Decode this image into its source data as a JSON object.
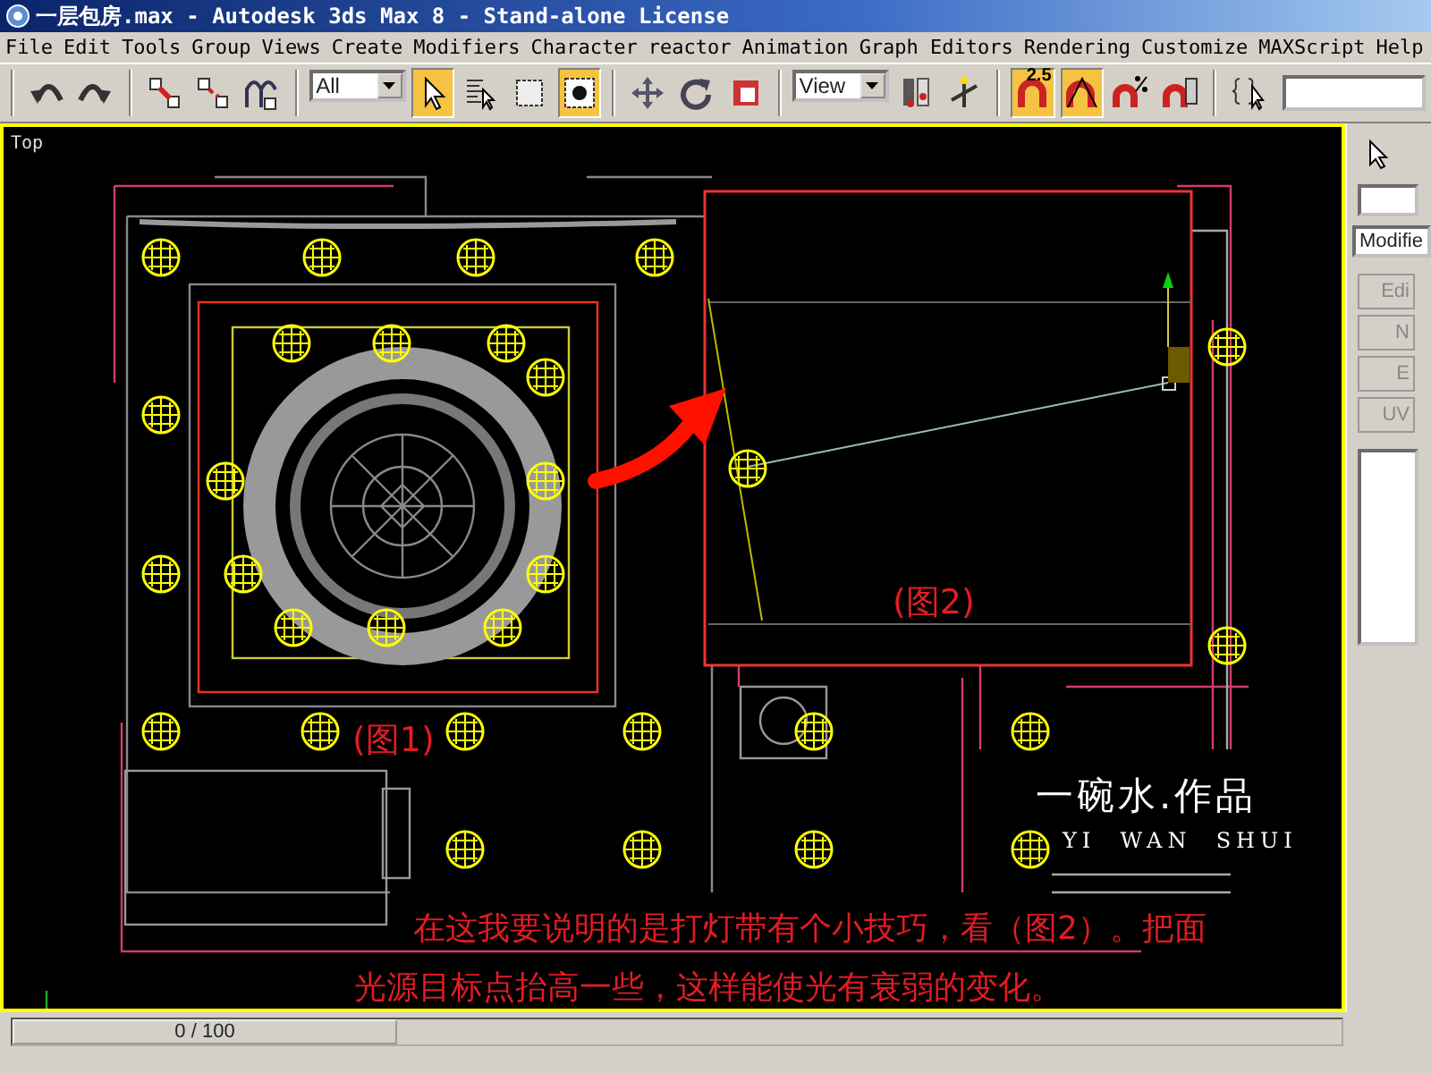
{
  "window": {
    "title": "一层包房.max - Autodesk 3ds Max 8  - Stand-alone License"
  },
  "menu": [
    "File",
    "Edit",
    "Tools",
    "Group",
    "Views",
    "Create",
    "Modifiers",
    "Character",
    "reactor",
    "Animation",
    "Graph Editors",
    "Rendering",
    "Customize",
    "MAXScript",
    "Help"
  ],
  "toolbar": [
    {
      "kind": "undo",
      "on": false
    },
    {
      "kind": "redo",
      "on": false
    },
    {
      "kind": "link",
      "on": false
    },
    {
      "kind": "unlink",
      "on": false
    },
    {
      "kind": "bind",
      "on": false
    },
    {
      "kind": "dropdown",
      "value": "All"
    },
    {
      "kind": "select",
      "on": true
    },
    {
      "kind": "select-by-name",
      "on": false
    },
    {
      "kind": "region",
      "on": false
    },
    {
      "kind": "crossing",
      "on": true
    },
    {
      "kind": "move",
      "on": false
    },
    {
      "kind": "rotate",
      "on": false
    },
    {
      "kind": "scale",
      "on": false
    },
    {
      "kind": "dropdown",
      "value": "View"
    },
    {
      "kind": "pivot",
      "on": false
    },
    {
      "kind": "axis",
      "on": false
    },
    {
      "kind": "snap",
      "on": true,
      "label": "2.5"
    },
    {
      "kind": "angle-snap",
      "on": true
    },
    {
      "kind": "percent-snap",
      "on": false
    },
    {
      "kind": "spinner-snap",
      "on": false
    },
    {
      "kind": "named-set",
      "on": false
    },
    {
      "kind": "field"
    }
  ],
  "viewport": {
    "label": "Top",
    "figure_1_caption": "(图1)",
    "figure_2_caption": "(图2)",
    "caption_lines": [
      "在这我要说明的是打灯带有个小技巧，看（图2）。把面",
      "光源目标点抬高一些，这样能使光有衰弱的变化。"
    ],
    "signature": {
      "title": "一碗水.作品",
      "subtitle": "YI  WAN  SHUI"
    }
  },
  "command_panel": {
    "modifier_list": "Modifie",
    "buttons": [
      "Edi",
      "N",
      "E",
      "UV"
    ]
  },
  "time_slider": {
    "label": "0 / 100",
    "level": 0
  }
}
